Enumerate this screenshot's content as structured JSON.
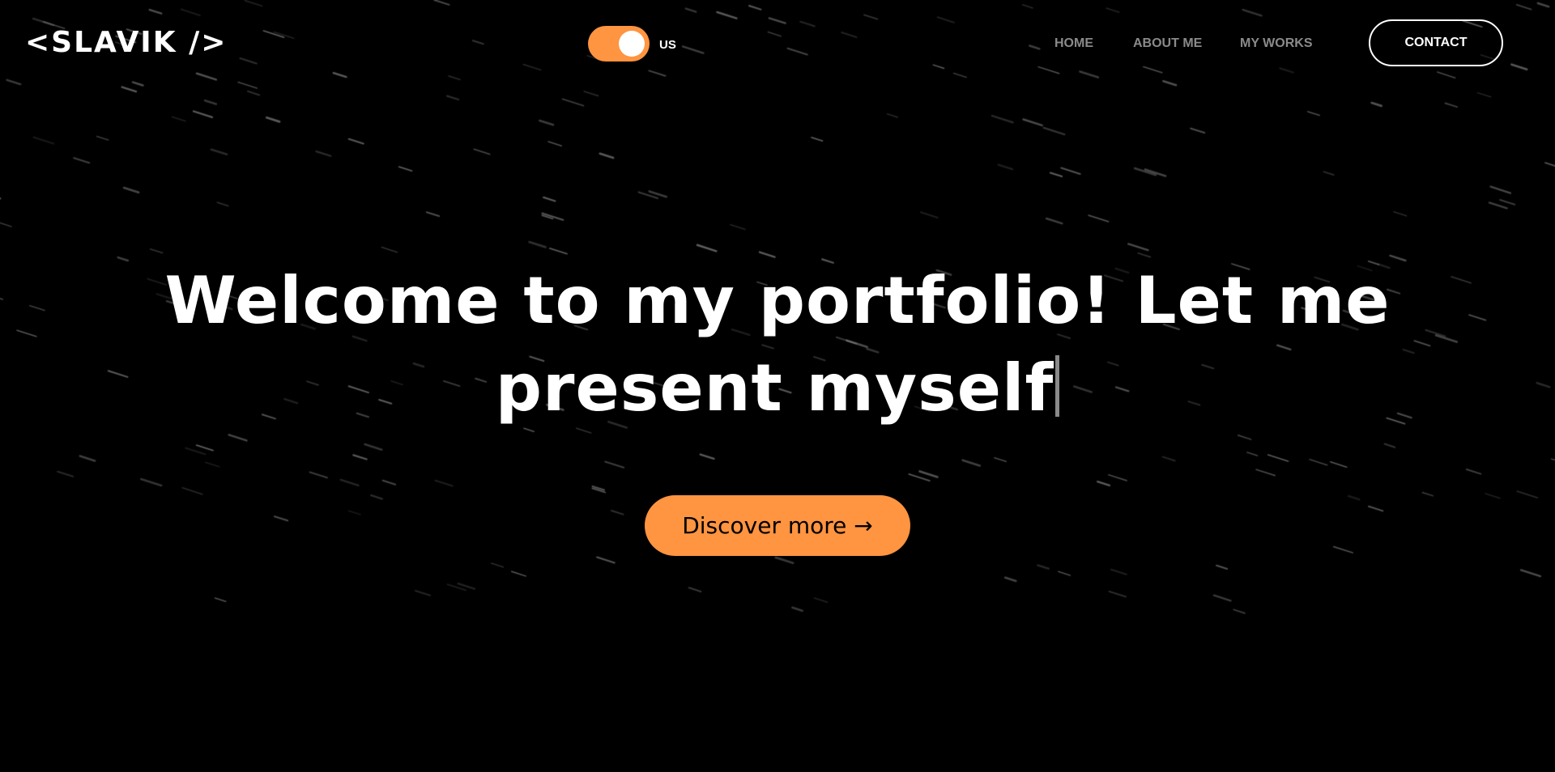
{
  "colors": {
    "background": "#000000",
    "accent": "#ff9441",
    "nav_text": "#8a8a8a",
    "text": "#ffffff"
  },
  "header": {
    "logo": "<SLAVIK />",
    "language_toggle": {
      "label": "US",
      "state": "on"
    },
    "nav": {
      "home": "HOME",
      "about": "ABOUT ME",
      "works": "MY WORKS"
    },
    "contact_label": "CONTACT"
  },
  "hero": {
    "title_line1": "Welcome to my portfolio! Let me",
    "title_line2": "present myself",
    "cta_label": "Discover more →"
  },
  "icons": {
    "toggle_knob": "toggle-knob-icon",
    "text_cursor": "text-caret-icon"
  }
}
